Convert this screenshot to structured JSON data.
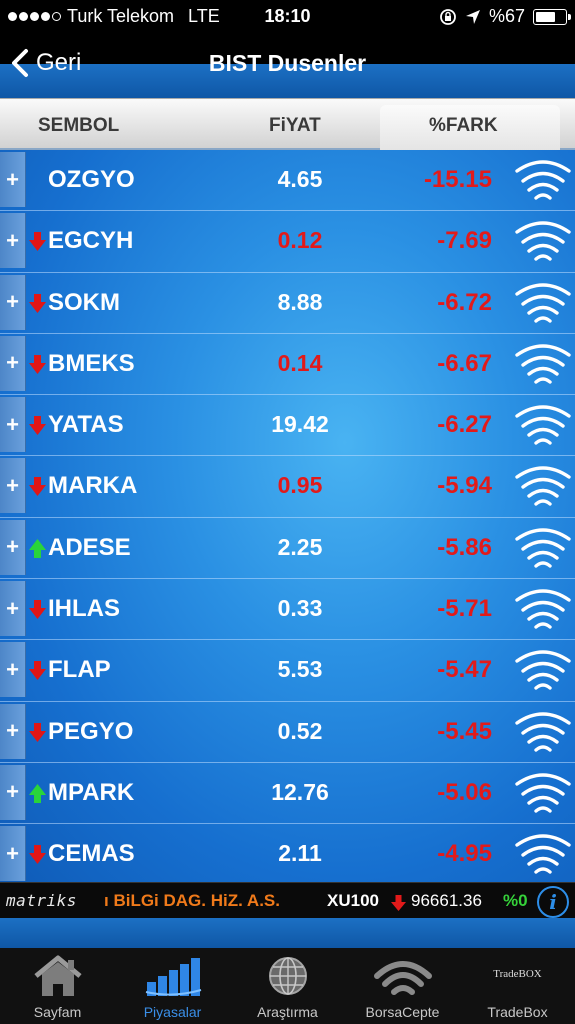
{
  "status_bar": {
    "carrier": "Turk Telekom",
    "network": "LTE",
    "time": "18:10",
    "battery": "%67",
    "battery_level": 0.67
  },
  "nav": {
    "back_label": "Geri",
    "title": "BIST Dusenler"
  },
  "columns": {
    "symbol": "SEMBOL",
    "price": "FiYAT",
    "change": "%FARK"
  },
  "rows": [
    {
      "symbol": "OZGYO",
      "price": "4.65",
      "change": "-15.15",
      "arrow": "none",
      "price_color": "white"
    },
    {
      "symbol": "EGCYH",
      "price": "0.12",
      "change": "-7.69",
      "arrow": "down",
      "price_color": "red"
    },
    {
      "symbol": "SOKM",
      "price": "8.88",
      "change": "-6.72",
      "arrow": "down",
      "price_color": "white"
    },
    {
      "symbol": "BMEKS",
      "price": "0.14",
      "change": "-6.67",
      "arrow": "down",
      "price_color": "red"
    },
    {
      "symbol": "YATAS",
      "price": "19.42",
      "change": "-6.27",
      "arrow": "down",
      "price_color": "white"
    },
    {
      "symbol": "MARKA",
      "price": "0.95",
      "change": "-5.94",
      "arrow": "down",
      "price_color": "red"
    },
    {
      "symbol": "ADESE",
      "price": "2.25",
      "change": "-5.86",
      "arrow": "up",
      "price_color": "white"
    },
    {
      "symbol": "IHLAS",
      "price": "0.33",
      "change": "-5.71",
      "arrow": "down",
      "price_color": "white"
    },
    {
      "symbol": "FLAP",
      "price": "5.53",
      "change": "-5.47",
      "arrow": "down",
      "price_color": "white"
    },
    {
      "symbol": "PEGYO",
      "price": "0.52",
      "change": "-5.45",
      "arrow": "down",
      "price_color": "white"
    },
    {
      "symbol": "MPARK",
      "price": "12.76",
      "change": "-5.06",
      "arrow": "up",
      "price_color": "white"
    },
    {
      "symbol": "CEMAS",
      "price": "2.11",
      "change": "-4.95",
      "arrow": "down",
      "price_color": "white"
    }
  ],
  "ticker": {
    "logo": "matriks",
    "news": "ı BiLGi DAG. HiZ. A.S.",
    "index_name": "XU100",
    "index_value": "96661.36",
    "index_change": "%0",
    "index_direction": "down"
  },
  "tabs": [
    {
      "label": "Sayfam",
      "icon": "home-icon",
      "active": false
    },
    {
      "label": "Piyasalar",
      "icon": "bar-chart-icon",
      "active": true
    },
    {
      "label": "Araştırma",
      "icon": "globe-icon",
      "active": false
    },
    {
      "label": "BorsaCepte",
      "icon": "signal-icon",
      "active": false
    },
    {
      "label": "TradeBox",
      "icon": "tradebox-icon",
      "active": false,
      "mark": "TradeBOX"
    }
  ],
  "colors": {
    "accent": "#2d8ee8",
    "negative": "#e21a1a",
    "positive": "#35d23a",
    "ticker_news": "#f07a1a"
  }
}
